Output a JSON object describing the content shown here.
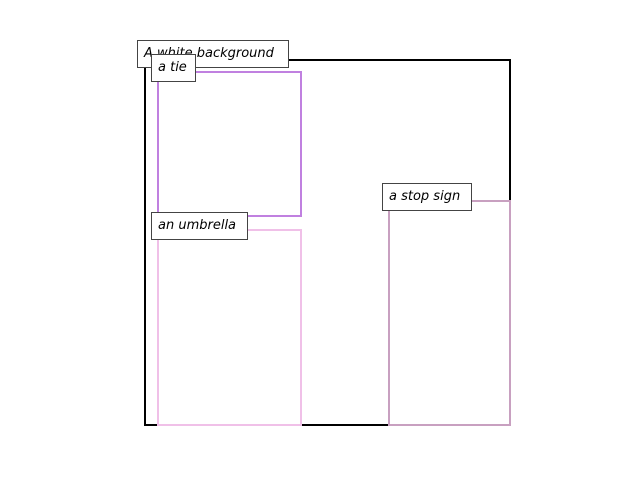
{
  "background": {
    "caption": "A white background",
    "border_color": "#000000"
  },
  "regions": [
    {
      "caption": "a tie",
      "color": "#c080e0"
    },
    {
      "caption": "an umbrella",
      "color": "#f0c0e8"
    },
    {
      "caption": "a stop sign",
      "color": "#c8a0c0"
    }
  ]
}
